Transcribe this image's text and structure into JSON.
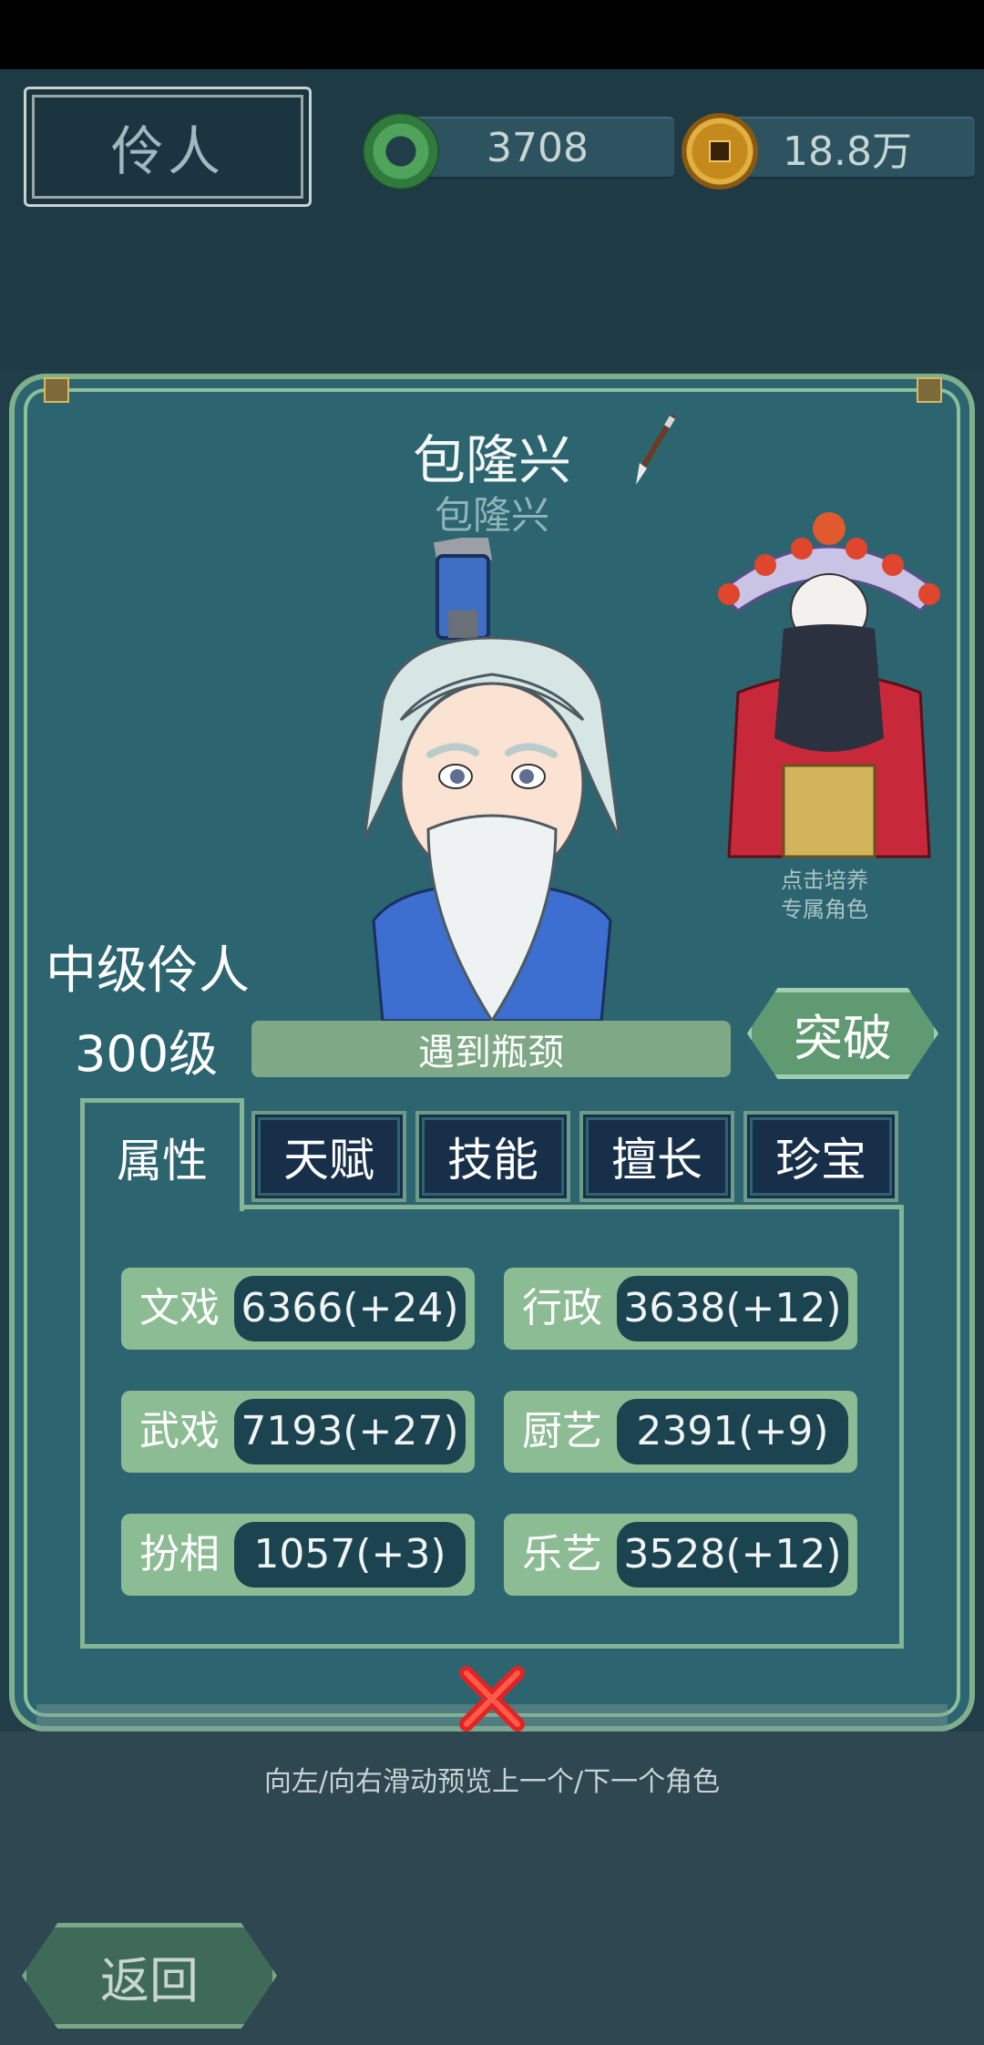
{
  "header": {
    "title": "伶人",
    "jade_amount": "3708",
    "coin_amount": "18.8万"
  },
  "character": {
    "name": "包隆兴",
    "subname": "包隆兴",
    "rank": "中级伶人",
    "level": "300级",
    "status": "遇到瓶颈",
    "breakthrough_label": "突破",
    "costume_hint_line1": "点击培养",
    "costume_hint_line2": "专属角色"
  },
  "tabs": [
    {
      "label": "属性",
      "active": true
    },
    {
      "label": "天赋",
      "active": false
    },
    {
      "label": "技能",
      "active": false
    },
    {
      "label": "擅长",
      "active": false
    },
    {
      "label": "珍宝",
      "active": false
    }
  ],
  "stats": [
    {
      "label": "文戏",
      "value": "6366(+24)"
    },
    {
      "label": "行政",
      "value": "3638(+12)"
    },
    {
      "label": "武戏",
      "value": "7193(+27)"
    },
    {
      "label": "厨艺",
      "value": "2391(+9)"
    },
    {
      "label": "扮相",
      "value": "1057(+3)"
    },
    {
      "label": "乐艺",
      "value": "3528(+12)"
    }
  ],
  "footer": {
    "swipe_hint": "向左/向右滑动预览上一个/下一个角色",
    "back_label": "返回"
  },
  "icons": {
    "jade": "jade-disc-icon",
    "coin": "copper-coin-icon",
    "close": "close-x-icon",
    "brush": "brush-icon"
  }
}
